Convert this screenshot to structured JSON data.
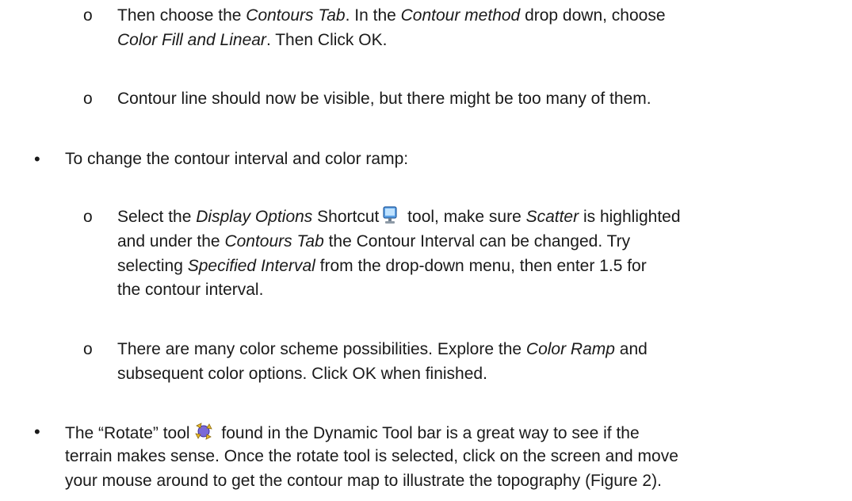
{
  "doc": {
    "item1": {
      "marker": "o",
      "p1": "Then choose the ",
      "i1": "Contours Tab",
      "p2": ". In the ",
      "i2": "Contour method",
      "p3": " drop down, choose",
      "i3": "Color Fill and Linear",
      "p4": ". Then Click OK."
    },
    "item2": {
      "marker": "o",
      "text": "Contour line should now be visible, but there might be too many of them."
    },
    "bullet1": {
      "marker": "•",
      "text": "To change the contour interval and color ramp:"
    },
    "item3": {
      "marker": "o",
      "p1": "Select the ",
      "i1": "Display Options",
      "p2": " Shortcut",
      "p3": " tool, make sure ",
      "i2": "Scatter",
      "p4": " is highlighted",
      "p5": "and under the ",
      "i3": "Contours Tab",
      "p6": " the Contour Interval can be changed. Try",
      "p7": "selecting ",
      "i4": "Specified Interval",
      "p8": " from the drop-down menu, then enter 1.5 for",
      "p9": "the contour interval."
    },
    "item4": {
      "marker": "o",
      "p1": "There are many color scheme possibilities. Explore the ",
      "i1": "Color Ramp",
      "p2": " and",
      "p3": "subsequent color options. Click OK when finished."
    },
    "bullet2": {
      "marker": "•",
      "p1": "The “Rotate” tool",
      "p2": " found in the Dynamic Tool bar is a great way to see if the",
      "p3": "terrain makes sense. Once the rotate tool is selected, click on the screen and move",
      "p4": "your mouse around to get the contour map to illustrate the topography (Figure 2)."
    }
  }
}
